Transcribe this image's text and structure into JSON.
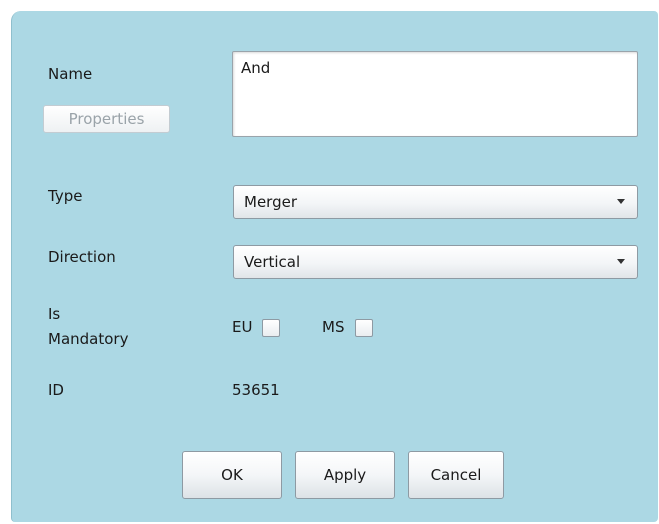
{
  "form": {
    "name_label": "Name",
    "name_value": "And",
    "properties_label": "Properties",
    "type_label": "Type",
    "type_value": "Merger",
    "direction_label": "Direction",
    "direction_value": "Vertical",
    "is_mandatory_label_1": "Is",
    "is_mandatory_label_2": "Mandatory",
    "eu_label": "EU",
    "eu_checked": false,
    "ms_label": "MS",
    "ms_checked": false,
    "id_label": "ID",
    "id_value": "53651"
  },
  "buttons": {
    "ok": "OK",
    "apply": "Apply",
    "cancel": "Cancel"
  },
  "icons": {
    "dropdown": "chevron-down-icon"
  },
  "colors": {
    "dialog_background": "#acd8e4",
    "disabled_text": "#9aa3a9"
  }
}
